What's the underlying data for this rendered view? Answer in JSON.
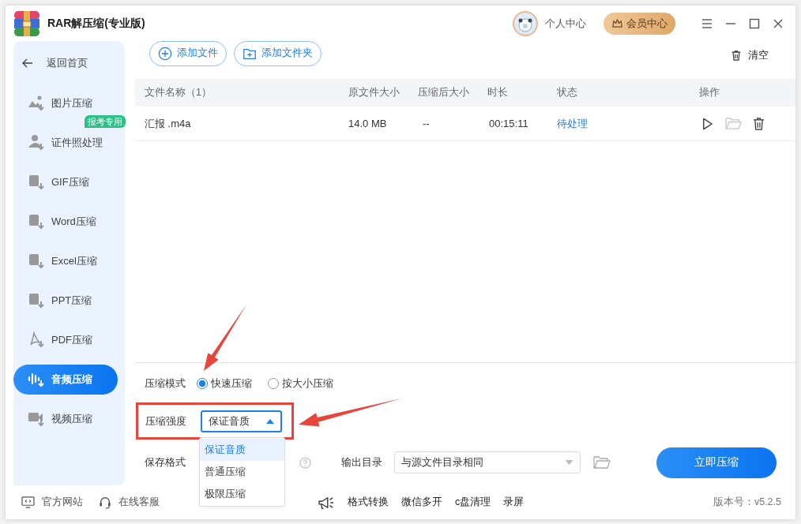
{
  "window": {
    "title": "RAR解压缩(专业版)"
  },
  "header": {
    "user_label": "个人中心",
    "vip_button": "会员中心"
  },
  "sidebar": {
    "back": "返回首页",
    "items": [
      {
        "label": "图片压缩",
        "selected": false
      },
      {
        "label": "证件照处理",
        "selected": false,
        "badge": "报考专用"
      },
      {
        "label": "GIF压缩",
        "selected": false
      },
      {
        "label": "Word压缩",
        "selected": false
      },
      {
        "label": "Excel压缩",
        "selected": false
      },
      {
        "label": "PPT压缩",
        "selected": false
      },
      {
        "label": "PDF压缩",
        "selected": false
      },
      {
        "label": "音频压缩",
        "selected": true
      },
      {
        "label": "视频压缩",
        "selected": false
      }
    ]
  },
  "toolbar": {
    "buttons": [
      "添加文件",
      "添加文件夹"
    ],
    "clear": "清空"
  },
  "table": {
    "columns": [
      "文件名称（1）",
      "原文件大小",
      "压缩后大小",
      "时长",
      "状态",
      "操作"
    ],
    "rows": [
      {
        "name": "汇报 .m4a",
        "original_size": "14.0 MB",
        "compressed_size": "--",
        "duration": "00:15:11",
        "status": "待处理"
      }
    ]
  },
  "settings": {
    "mode_label": "压缩模式",
    "modes": [
      {
        "label": "快速压缩",
        "selected": true
      },
      {
        "label": "按大小压缩",
        "selected": false
      }
    ],
    "strength_label": "压缩强度",
    "strength_value": "保证音质",
    "strength_expanded": true,
    "strength_options": [
      {
        "label": "保证音质",
        "selected": true
      },
      {
        "label": "普通压缩",
        "selected": false
      },
      {
        "label": "极限压缩",
        "selected": false
      }
    ],
    "format_label": "保存格式",
    "output_label": "输出目录",
    "output_value": "与源文件目录相同",
    "start_button": "立即压缩"
  },
  "footer": {
    "links": [
      "官方网站",
      "在线客服"
    ],
    "tools": [
      "格式转换",
      "微信多开",
      "c盘清理",
      "录屏"
    ],
    "version": "版本号：v5.2.5"
  }
}
